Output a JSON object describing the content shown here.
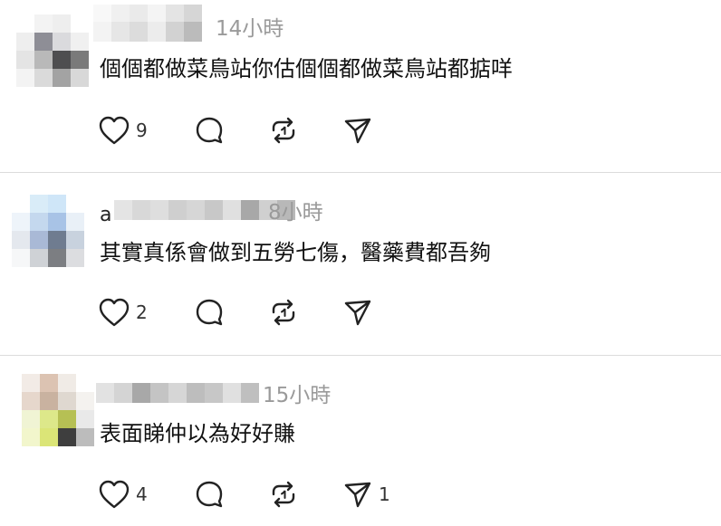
{
  "posts": [
    {
      "time": "14小時",
      "text": "個個都做菜鳥站你估個個都做菜鳥站都掂咩",
      "like_count": "9",
      "share_count": "",
      "avatar_colors": [
        "#ffffff",
        "#f3f3f3",
        "#eeeeee",
        "#ffffff",
        "#eeeeee",
        "#8e8e96",
        "#dadadd",
        "#f0f0f0",
        "#e4e4e4",
        "#b9b9b9",
        "#4e4e50",
        "#7a7a7a",
        "#f3f3f3",
        "#dadada",
        "#a3a3a3",
        "#d8d8d8"
      ],
      "name_colors": [
        "#f3f3f3",
        "#e6e6e6",
        "#dcdcdc",
        "#ececec",
        "#d2d2d2",
        "#bbbbbb"
      ]
    },
    {
      "time": "8小時",
      "name_prefix": "a",
      "text": "其實真係會做到五勞七傷，醫藥費都吾夠",
      "like_count": "2",
      "share_count": "",
      "avatar_colors": [
        "#ffffff",
        "#d9ecf8",
        "#cfe6f8",
        "#ffffff",
        "#eef4fa",
        "#c4d8ee",
        "#a8c3e6",
        "#e9f0f7",
        "#e4e8ee",
        "#a9b9d6",
        "#6f7c90",
        "#c8d2de",
        "#f6f7f8",
        "#cfd2d6",
        "#7c7e82",
        "#dcdde0"
      ],
      "name_colors": [
        "#e4e4e4",
        "#d8d8d8",
        "#dedede",
        "#cfcfcf",
        "#d6d6d6",
        "#c8c8c8",
        "#e0e0e0",
        "#a8a8a8",
        "#d0d0d0",
        "#b8b8b8"
      ]
    },
    {
      "time": "15小時",
      "text": "表面睇仲以為好好賺",
      "like_count": "4",
      "share_count": "1",
      "avatar_colors": [
        "#f2ebe6",
        "#dcc3b2",
        "#f0ebe6",
        "#ffffff",
        "#e6d7cc",
        "#c9b2a0",
        "#dfd8d0",
        "#f4f2ef",
        "#f0f4d4",
        "#dde88a",
        "#b6c054",
        "#e9e9e9",
        "#f2f6cc",
        "#dbe577",
        "#3e3e3e",
        "#bcbcbc"
      ],
      "name_colors": [
        "#e2e2e2",
        "#d4d4d4",
        "#a8a8a8",
        "#c4c4c4",
        "#d6d6d6",
        "#bdbdbd",
        "#c7c7c7",
        "#e0e0e0",
        "#bfbfbf"
      ]
    }
  ],
  "icons": {
    "like": "heart-icon",
    "comment": "comment-bubble-icon",
    "repost": "repost-icon",
    "share": "send-icon"
  }
}
